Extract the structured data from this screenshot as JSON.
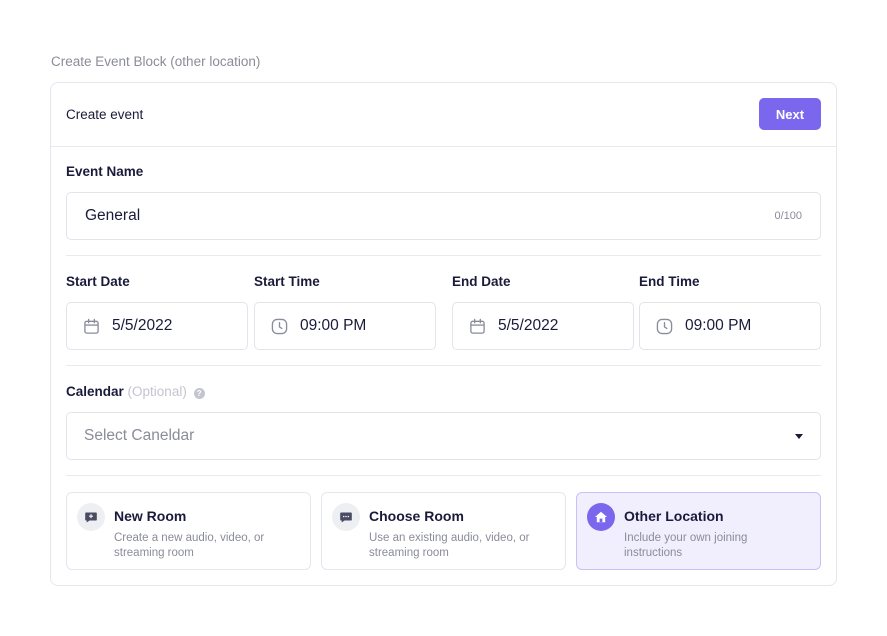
{
  "caption": "Create Event Block (other location)",
  "header": {
    "title": "Create event",
    "next_label": "Next"
  },
  "event_name": {
    "label": "Event Name",
    "value": "General",
    "counter": "0/100"
  },
  "schedule": {
    "start_date": {
      "label": "Start Date",
      "value": "5/5/2022",
      "icon": "calendar-icon"
    },
    "start_time": {
      "label": "Start Time",
      "value": "09:00 PM",
      "icon": "clock-icon"
    },
    "end_date": {
      "label": "End Date",
      "value": "5/5/2022",
      "icon": "calendar-icon"
    },
    "end_time": {
      "label": "End Time",
      "value": "09:00 PM",
      "icon": "clock-icon"
    }
  },
  "calendar": {
    "label": "Calendar",
    "optional": "(Optional)",
    "placeholder": "Select Caneldar",
    "help_icon": "question-icon"
  },
  "location_options": [
    {
      "title": "New Room",
      "desc": "Create a new audio, video, or streaming room",
      "icon": "plus-chat-icon",
      "selected": false
    },
    {
      "title": "Choose Room",
      "desc": "Use an existing audio, video, or streaming room",
      "icon": "chat-icon",
      "selected": false
    },
    {
      "title": "Other Location",
      "desc": "Include your own joining instructions",
      "icon": "home-icon",
      "selected": true
    }
  ],
  "colors": {
    "accent": "#7b66ee",
    "selected_bg": "#f1effe",
    "text": "#1a1b3a",
    "muted": "#8a8c99",
    "border": "#e3e4ea"
  }
}
